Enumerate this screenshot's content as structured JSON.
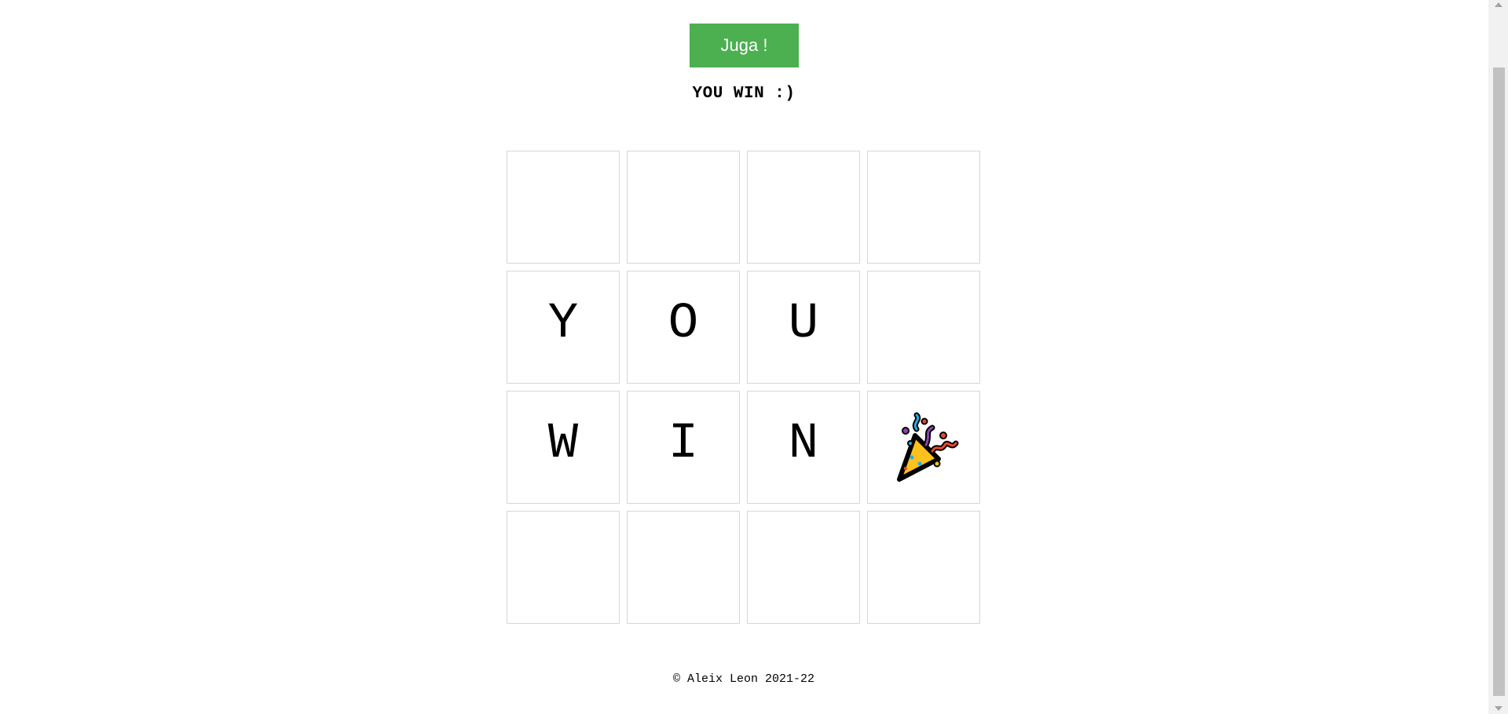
{
  "play_button": {
    "label": "Juga !",
    "color": "#4caf50"
  },
  "status": {
    "text": "YOU WIN :)"
  },
  "board": {
    "tiles": [
      "",
      "",
      "",
      "",
      "Y",
      "O",
      "U",
      "",
      "W",
      "I",
      "N",
      "",
      "",
      "",
      "",
      ""
    ],
    "special_tile_icon": "party-popper-icon"
  },
  "footer": {
    "text": "© Aleix Leon 2021-22"
  }
}
